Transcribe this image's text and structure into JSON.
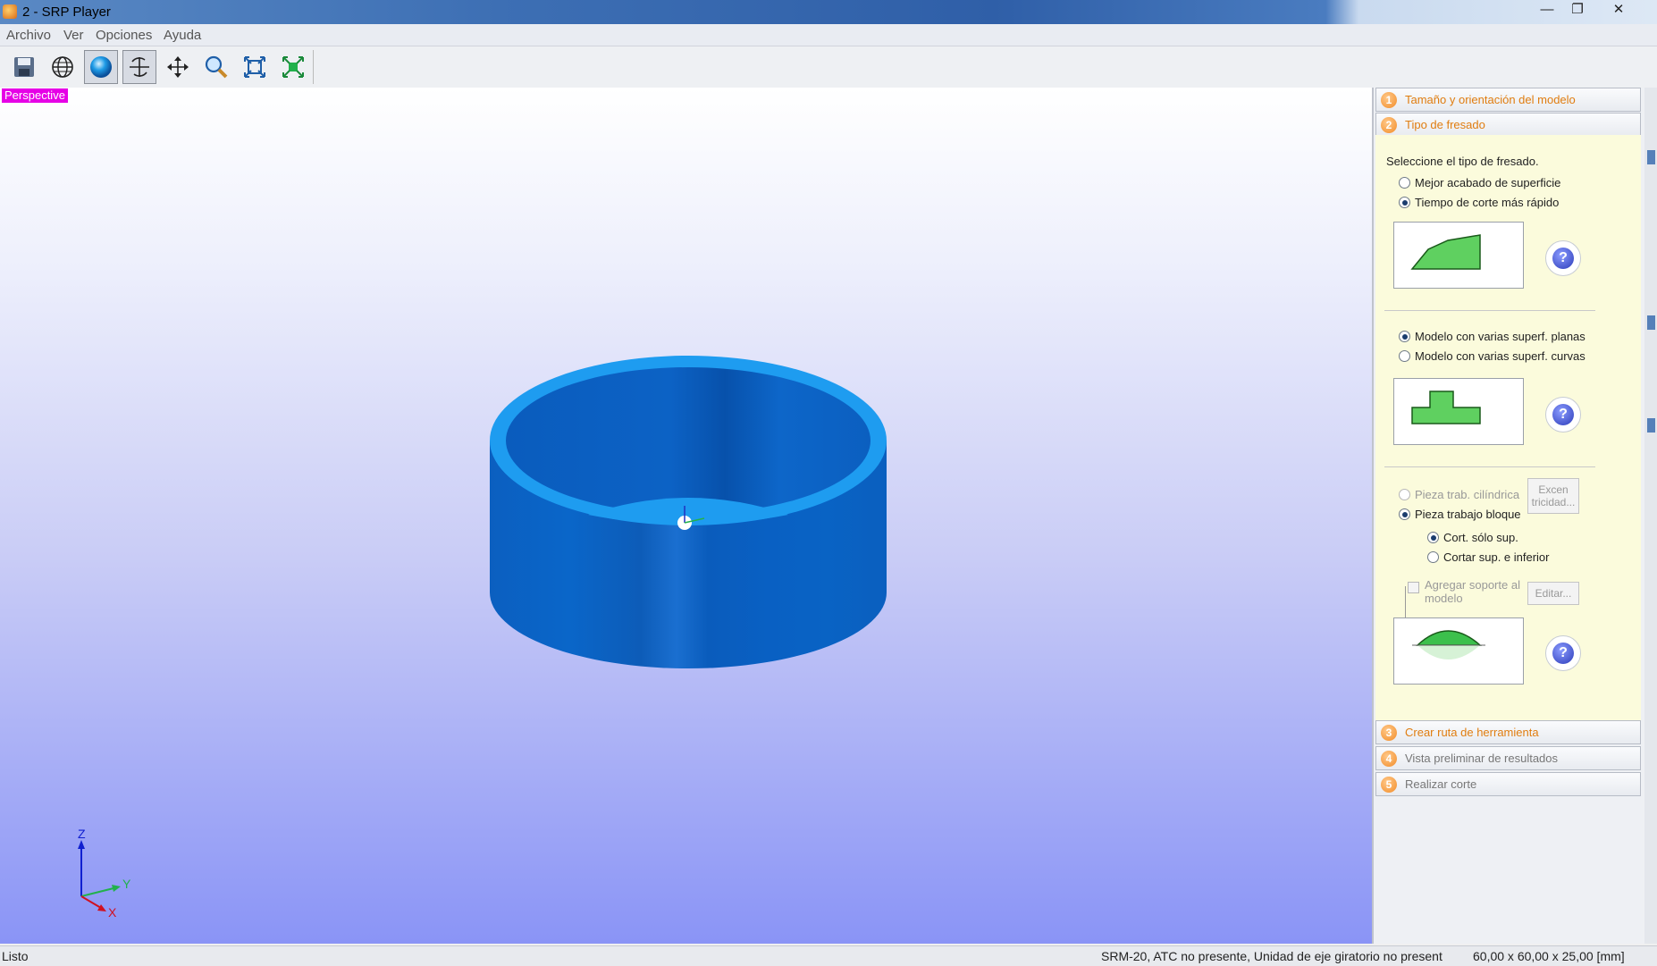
{
  "window": {
    "title": "2 - SRP Player",
    "min_icon": "minimize-icon",
    "max_icon": "restore-icon",
    "close_icon": "close-icon",
    "min_glyph": "—",
    "max_glyph": "❐",
    "close_glyph": "✕"
  },
  "menu": [
    "Archivo",
    "Ver",
    "Opciones",
    "Ayuda"
  ],
  "toolbar": {
    "tools": [
      {
        "name": "save-icon"
      },
      {
        "name": "wireframe-globe-icon"
      },
      {
        "name": "shaded-sphere-icon",
        "active": true
      },
      {
        "name": "rotate-icon",
        "active": true
      },
      {
        "name": "pan-icon"
      },
      {
        "name": "zoom-icon"
      },
      {
        "name": "fit-view-icon"
      },
      {
        "name": "zoom-extents-icon"
      }
    ]
  },
  "viewport": {
    "label": "Perspective",
    "model_color": "#0a63c2",
    "axes": {
      "z": "Z",
      "y": "Y",
      "x": "X"
    }
  },
  "panel": {
    "steps": [
      {
        "num": "1",
        "label": "Tamaño y orientación del modelo"
      },
      {
        "num": "2",
        "label": "Tipo de fresado"
      },
      {
        "num": "3",
        "label": "Crear ruta de herramienta"
      },
      {
        "num": "4",
        "label": "Vista preliminar de resultados"
      },
      {
        "num": "5",
        "label": "Realizar corte"
      }
    ],
    "step2": {
      "prompt": "Seleccione el tipo de fresado.",
      "finish_best": "Mejor acabado de superficie",
      "finish_fast": "Tiempo de corte más rápido",
      "model_flat": "Modelo con varias superf. planas",
      "model_curved": "Modelo con varias superf. curvas",
      "work_cyl": "Pieza trab. cilíndrica",
      "work_block": "Pieza trabajo bloque",
      "eccentric_btn": "Excen tricidad...",
      "cut_top": "Cort. sólo sup.",
      "cut_both": "Cortar sup. e inferior",
      "add_support": "Agregar soporte al modelo",
      "edit_btn": "Editar...",
      "help_glyph": "?"
    },
    "accent": "#e07d10"
  },
  "status": {
    "left": "Listo",
    "machine": "SRM-20, ATC no presente, Unidad de eje giratorio no present",
    "dimensions": "60,00 x  60,00 x  25,00 [mm]"
  }
}
